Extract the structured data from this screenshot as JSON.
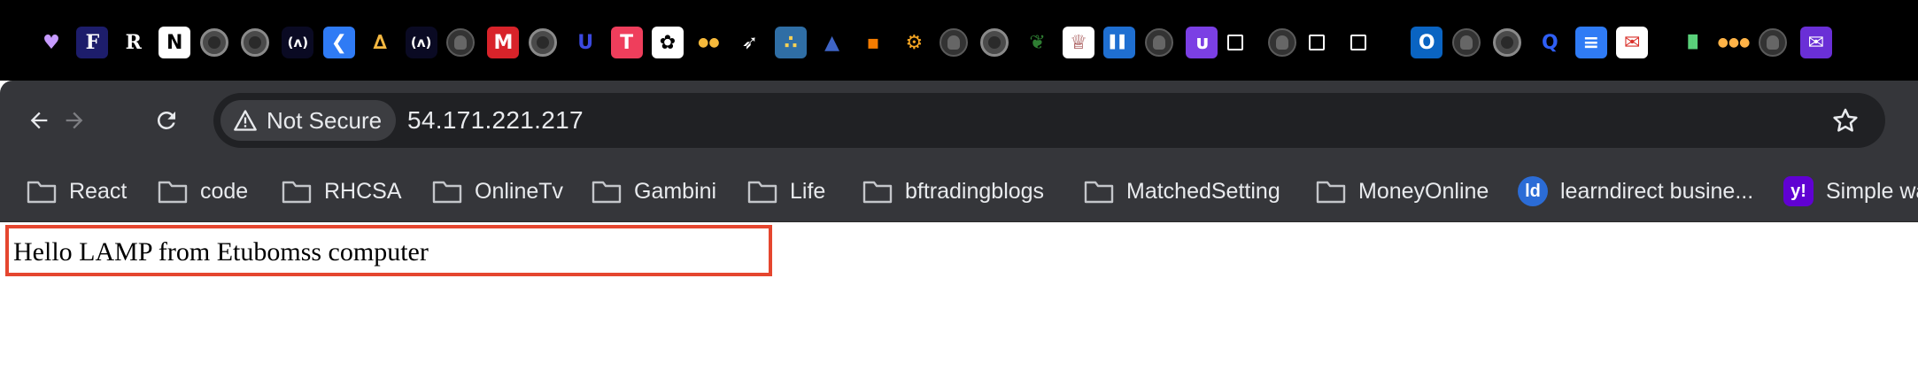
{
  "pinned_tabs": [
    {
      "icon": "heart-icon",
      "glyph": "♥",
      "color": "#c79bff",
      "bg": "transparent"
    },
    {
      "icon": "fancy-f-icon",
      "glyph": "F",
      "color": "#ffffff",
      "bg": "#1d1d6b"
    },
    {
      "icon": "r-logo-icon",
      "glyph": "R",
      "color": "#ffffff",
      "bg": "transparent"
    },
    {
      "icon": "notion-icon",
      "glyph": "N",
      "color": "#000000",
      "bg": "#ffffff"
    },
    {
      "icon": "globe-icon",
      "glyph": "",
      "color": "#ffffff",
      "bg": "globe"
    },
    {
      "icon": "globe-icon",
      "glyph": "",
      "color": "#ffffff",
      "bg": "globe"
    },
    {
      "icon": "freecodecamp-icon",
      "glyph": "(ʌ)",
      "color": "#ffffff",
      "bg": "fcc"
    },
    {
      "icon": "blue-circle-icon",
      "glyph": "❮",
      "color": "#ffffff",
      "bg": "#2f7bf5"
    },
    {
      "icon": "campfire-icon",
      "glyph": "∆",
      "color": "#f5b841",
      "bg": "transparent"
    },
    {
      "icon": "freecodecamp-icon",
      "glyph": "(ʌ)",
      "color": "#ffffff",
      "bg": "fcc"
    },
    {
      "icon": "github-icon",
      "glyph": "",
      "color": "#ffffff",
      "bg": "github"
    },
    {
      "icon": "m-logo-icon",
      "glyph": "M",
      "color": "#ffffff",
      "bg": "#d8232a"
    },
    {
      "icon": "globe-icon",
      "glyph": "",
      "color": "#ffffff",
      "bg": "globe"
    },
    {
      "icon": "udemy-u-icon",
      "glyph": "U",
      "color": "#3b49df",
      "bg": "transparent"
    },
    {
      "icon": "t-logo-icon",
      "glyph": "T",
      "color": "#ffffff",
      "bg": "#ef3e5c"
    },
    {
      "icon": "openai-icon",
      "glyph": "✿",
      "color": "#000000",
      "bg": "#ffffff"
    },
    {
      "icon": "dots-icon",
      "glyph": "●●",
      "color": "#f6b93b",
      "bg": "transparent"
    },
    {
      "icon": "rocket-icon",
      "glyph": "➶",
      "color": "#ffffff",
      "bg": "transparent"
    },
    {
      "icon": "python-icon",
      "glyph": "∴",
      "color": "#f7d154",
      "bg": "#2f6ea5"
    },
    {
      "icon": "sailboat-icon",
      "glyph": "▲",
      "color": "#3e64c6",
      "bg": "transparent"
    },
    {
      "icon": "orange-nodes-icon",
      "glyph": "▪",
      "color": "#f57c00",
      "bg": "transparent"
    },
    {
      "icon": "lightbulb-icon",
      "glyph": "⚙",
      "color": "#f6a623",
      "bg": "transparent"
    },
    {
      "icon": "github-icon",
      "glyph": "",
      "color": "#ffffff",
      "bg": "github"
    },
    {
      "icon": "globe-icon",
      "glyph": "",
      "color": "#ffffff",
      "bg": "globe"
    },
    {
      "icon": "coat-of-arms-icon",
      "glyph": "❦",
      "color": "#2e7d32",
      "bg": "transparent"
    },
    {
      "icon": "crest-icon",
      "glyph": "♕",
      "color": "#8e2a2a",
      "bg": "#ffffff"
    },
    {
      "icon": "trello-icon",
      "glyph": "▌▌",
      "color": "#ffffff",
      "bg": "#1f6fd1"
    },
    {
      "icon": "github-icon",
      "glyph": "",
      "color": "#ffffff",
      "bg": "github"
    },
    {
      "icon": "upwork-u-icon",
      "glyph": "ᴜ",
      "color": "#ffffff",
      "bg": "#7b3fe4"
    },
    {
      "icon": "blank-square-icon",
      "glyph": "",
      "color": "#ffffff",
      "bg": "square"
    },
    {
      "icon": "github-icon",
      "glyph": "",
      "color": "#ffffff",
      "bg": "github"
    },
    {
      "icon": "blank-square-icon",
      "glyph": "",
      "color": "#ffffff",
      "bg": "square"
    },
    {
      "icon": "blank-square-icon",
      "glyph": "",
      "color": "#ffffff",
      "bg": "square"
    },
    {
      "icon": "outlook-icon",
      "glyph": "O",
      "color": "#ffffff",
      "bg": "#0a64c2"
    },
    {
      "icon": "github-icon",
      "glyph": "",
      "color": "#ffffff",
      "bg": "github"
    },
    {
      "icon": "globe-icon",
      "glyph": "",
      "color": "#ffffff",
      "bg": "globe"
    },
    {
      "icon": "blue-q-icon",
      "glyph": "Q",
      "color": "#2f5ff5",
      "bg": "transparent"
    },
    {
      "icon": "google-docs-icon",
      "glyph": "≡",
      "color": "#ffffff",
      "bg": "#2f7bf5"
    },
    {
      "icon": "gmail-like-icon",
      "glyph": "✉",
      "color": "#d9302a",
      "bg": "#ffffff"
    },
    {
      "icon": "chart-icon",
      "glyph": "▐▌",
      "color": "#5ad17a",
      "bg": "transparent"
    },
    {
      "icon": "colorful-dots-icon",
      "glyph": "●●●",
      "color": "#ffb347",
      "bg": "transparent"
    },
    {
      "icon": "github-icon",
      "glyph": "",
      "color": "#ffffff",
      "bg": "github"
    },
    {
      "icon": "purple-mail-icon",
      "glyph": "✉",
      "color": "#ffffff",
      "bg": "#6a2fd6"
    }
  ],
  "toolbar": {
    "back_icon": "arrow-left-icon",
    "forward_icon": "arrow-right-icon",
    "reload_icon": "reload-icon",
    "security_label": "Not Secure",
    "url": "54.171.221.217",
    "bookmark_icon": "star-icon"
  },
  "bookmarks": [
    {
      "label": "React",
      "icon": "folder-icon"
    },
    {
      "label": "code",
      "icon": "folder-icon"
    },
    {
      "label": "RHCSA",
      "icon": "folder-icon"
    },
    {
      "label": "OnlineTv",
      "icon": "folder-icon"
    },
    {
      "label": "Gambini",
      "icon": "folder-icon"
    },
    {
      "label": "Life",
      "icon": "folder-icon"
    },
    {
      "label": "bftradingblogs",
      "icon": "folder-icon"
    },
    {
      "label": "MatchedSetting",
      "icon": "folder-icon"
    },
    {
      "label": "MoneyOnline",
      "icon": "folder-icon"
    },
    {
      "label": "learndirect busine...",
      "icon": "learndirect-icon",
      "favicon_text": "ld",
      "favicon_bg": "#2b6cd6"
    },
    {
      "label": "Simple wa",
      "icon": "yahoo-icon",
      "favicon_text": "y!",
      "favicon_bg": "#6001d2"
    }
  ],
  "page": {
    "text": "Hello LAMP from Etubomss computer",
    "highlight_color": "#e5462f"
  }
}
